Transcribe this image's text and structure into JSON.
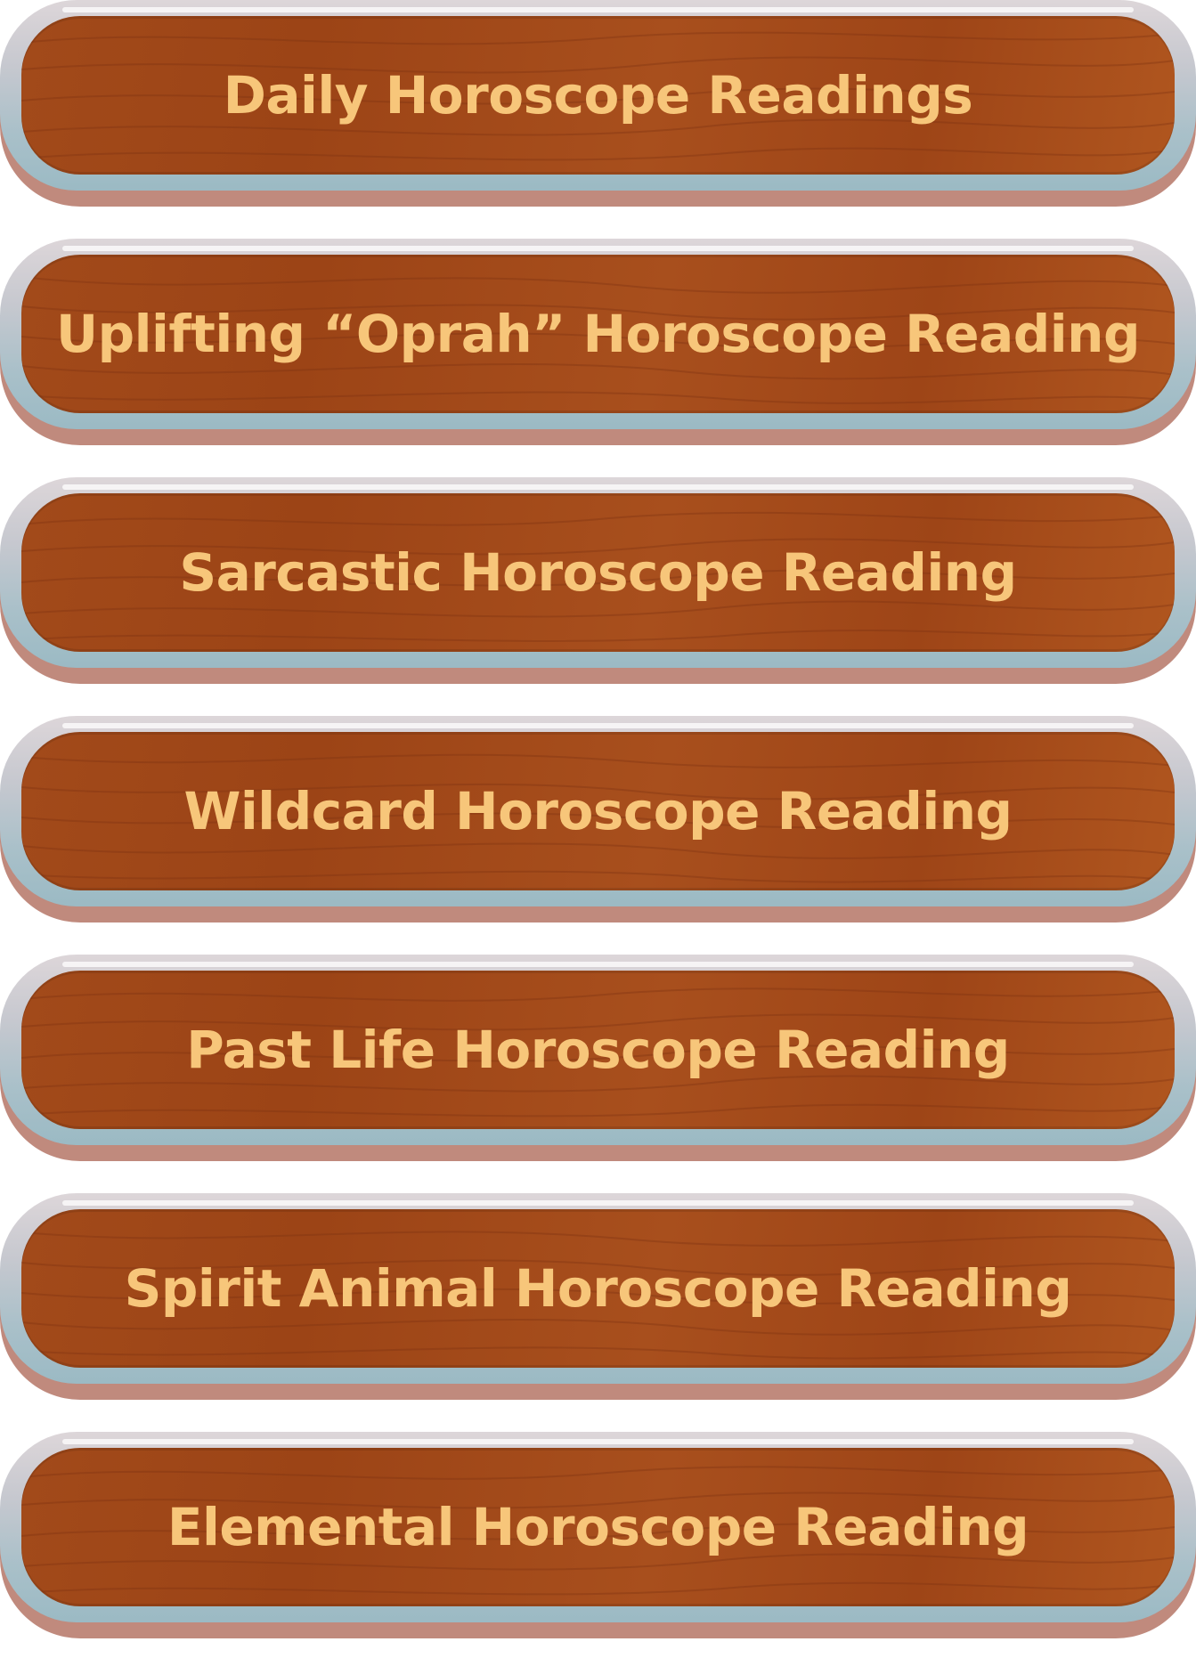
{
  "buttons": [
    {
      "label": "Daily Horoscope Readings"
    },
    {
      "label": "Uplifting “Oprah” Horoscope Reading"
    },
    {
      "label": "Sarcastic Horoscope Reading"
    },
    {
      "label": "Wildcard Horoscope Reading"
    },
    {
      "label": "Past Life Horoscope Reading"
    },
    {
      "label": "Spirit Animal Horoscope Reading"
    },
    {
      "label": "Elemental Horoscope Reading"
    }
  ],
  "colors": {
    "label_text": "#f7c67a",
    "wood": "#a24a1a",
    "frame": "#a9c0c9",
    "rim_shadow": "#c08a7d"
  }
}
